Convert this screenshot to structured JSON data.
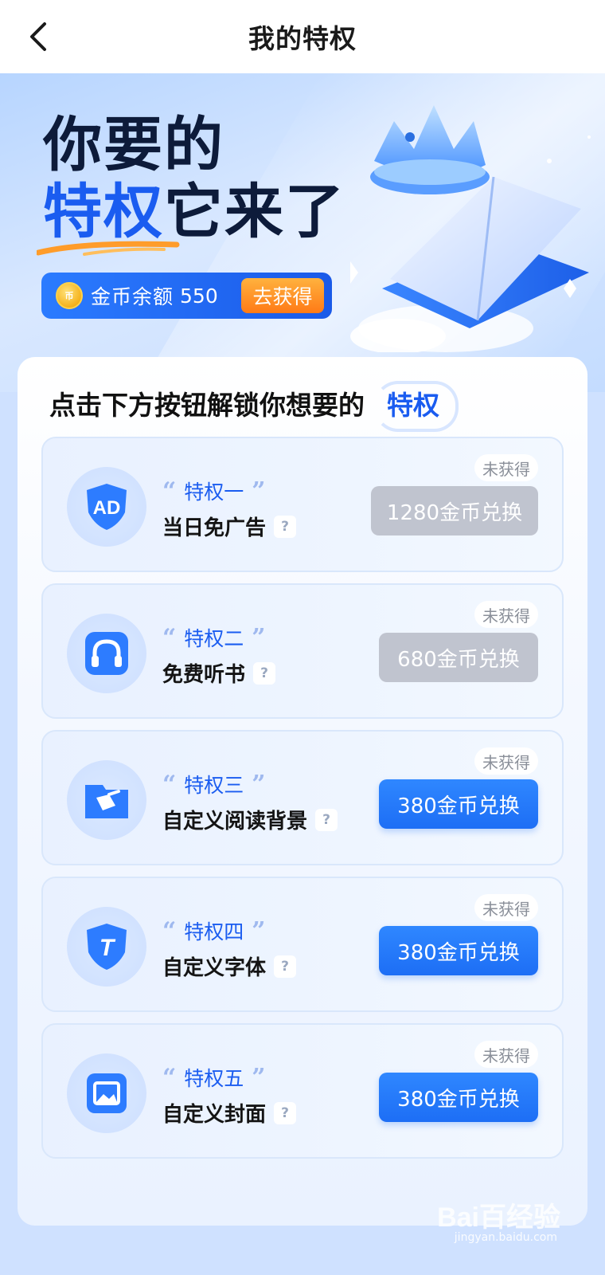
{
  "header": {
    "title": "我的特权"
  },
  "hero": {
    "line1": "你要的",
    "line2_accent": "特权",
    "line2_rest": "它来了",
    "coin_label": "金币余额",
    "coin_value": "550",
    "coin_get_label": "去获得"
  },
  "panel": {
    "title": "点击下方按钮解锁你想要的",
    "title_tag": "特权"
  },
  "privileges": [
    {
      "tier": "特权一",
      "name": "当日免广告",
      "status": "未获得",
      "redeem": "1280金币兑换",
      "enabled": false,
      "icon": "ad-icon"
    },
    {
      "tier": "特权二",
      "name": "免费听书",
      "status": "未获得",
      "redeem": "680金币兑换",
      "enabled": false,
      "icon": "headphones-icon"
    },
    {
      "tier": "特权三",
      "name": "自定义阅读背景",
      "status": "未获得",
      "redeem": "380金币兑换",
      "enabled": true,
      "icon": "paint-bucket-icon"
    },
    {
      "tier": "特权四",
      "name": "自定义字体",
      "status": "未获得",
      "redeem": "380金币兑换",
      "enabled": true,
      "icon": "font-icon"
    },
    {
      "tier": "特权五",
      "name": "自定义封面",
      "status": "未获得",
      "redeem": "380金币兑换",
      "enabled": true,
      "icon": "image-icon"
    }
  ],
  "help_glyph": "?",
  "quote_open": "“",
  "quote_close": "”",
  "watermark": {
    "brand": "Bai百经验",
    "url": "jingyan.baidu.com"
  },
  "colors": {
    "accent": "#1a5cf0",
    "disabled": "#c0c4cf",
    "orange": "#ff8a1f"
  }
}
